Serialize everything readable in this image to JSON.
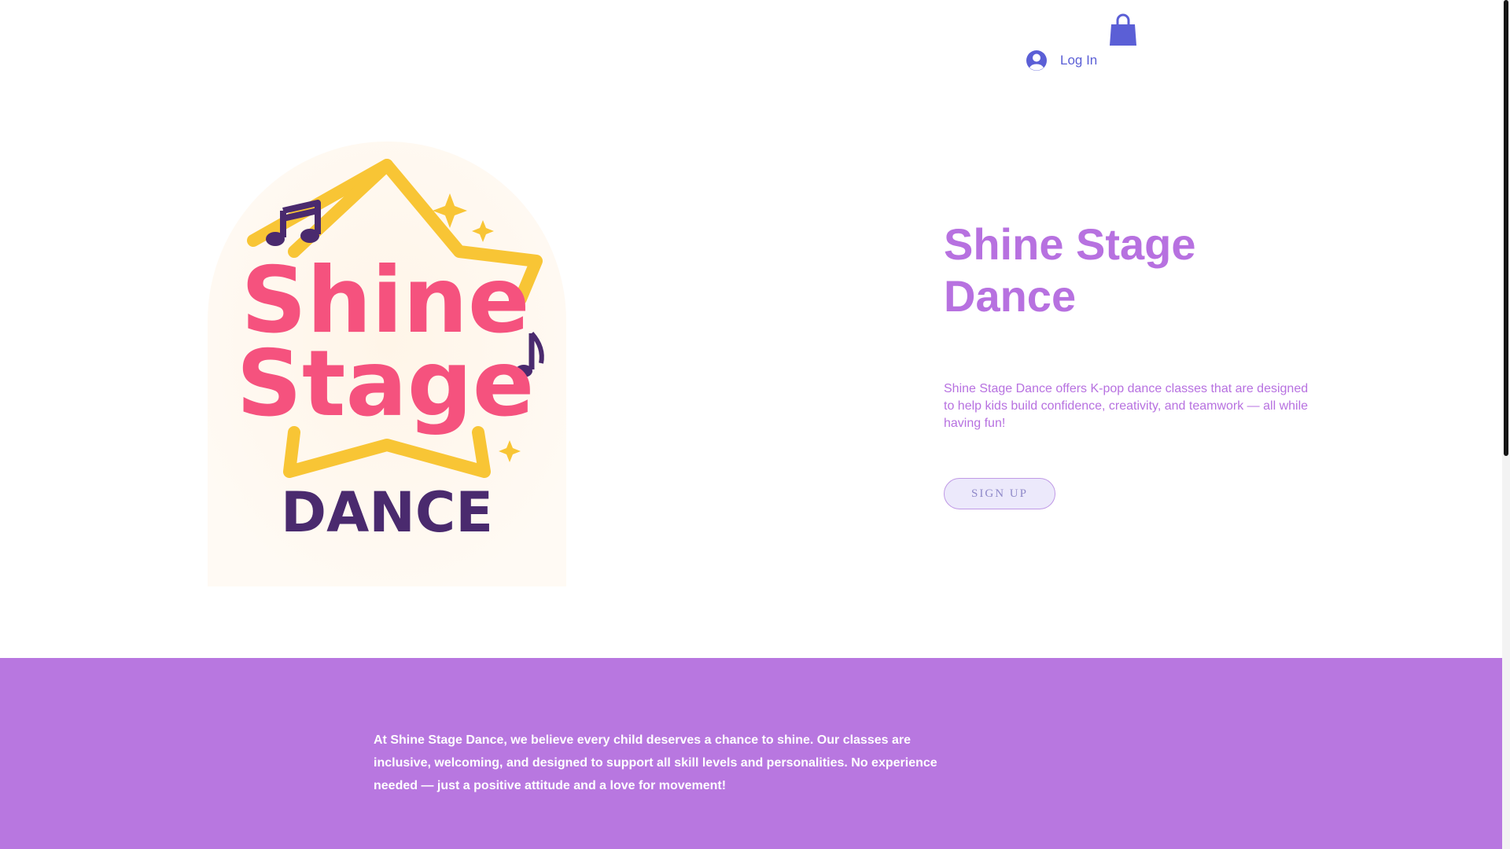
{
  "header": {
    "login_label": "Log In",
    "cart_icon": "shopping-bag-icon",
    "login_icon": "user-avatar-icon",
    "accent_color": "#5b5fd6"
  },
  "logo": {
    "line1": "Shine",
    "line2": "Stage",
    "line3": "DANCE",
    "colors": {
      "pink": "#f5527e",
      "yellow": "#f8c535",
      "purple": "#4a2a6e",
      "background": "#fff8ef"
    }
  },
  "hero": {
    "title": "Shine Stage Dance",
    "description": "Shine Stage Dance offers K-pop dance classes that are designed to help kids build confidence, creativity, and teamwork — all while having fun!",
    "signup_label": "SIGN UP",
    "title_color": "#b771e0"
  },
  "band": {
    "text": "At Shine Stage Dance, we believe every child deserves a chance to shine. Our classes are inclusive, welcoming, and designed to support all skill levels and personalities. No experience needed — just a positive attitude and a love for movement!",
    "background_color": "#b877e0"
  }
}
